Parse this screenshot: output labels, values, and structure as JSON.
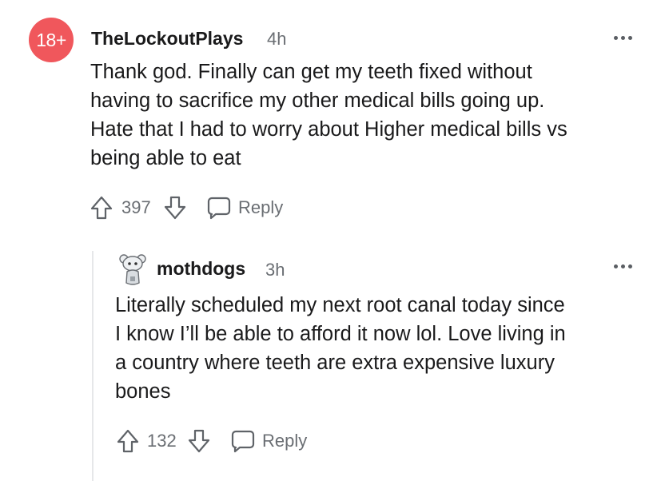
{
  "comment": {
    "avatar_text": "18+",
    "username": "TheLockoutPlays",
    "time": "4h",
    "body": "Thank god. Finally can get my teeth fixed without\nhaving to sacrifice my other medical bills going up.\nHate that I had to worry about Higher medical bills vs\nbeing able to eat",
    "votes": "397",
    "reply_label": "Reply"
  },
  "reply": {
    "username": "mothdogs",
    "time": "3h",
    "body": "Literally scheduled my next root canal today since\nI know I’ll be able to afford it now lol. Love living in\na country where teeth are extra expensive luxury\nbones",
    "votes": "132",
    "reply_label": "Reply"
  },
  "icons": {
    "upvote": "upvote-arrow-icon",
    "downvote": "downvote-arrow-icon",
    "reply": "speech-bubble-icon",
    "more": "more-options-icon",
    "avatar": "snoo-avatar-icon"
  }
}
